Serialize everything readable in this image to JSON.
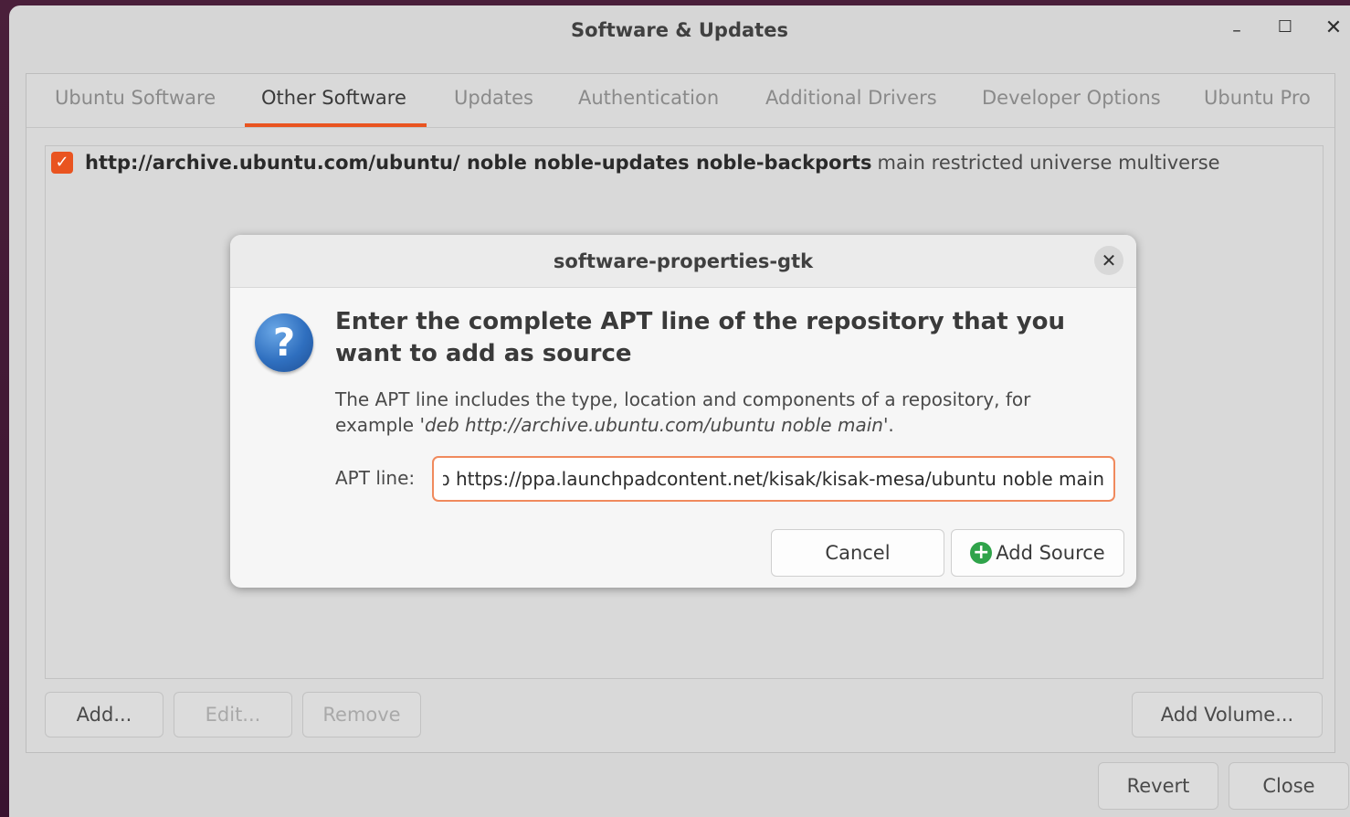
{
  "window": {
    "title": "Software & Updates",
    "minimize_glyph": "–",
    "maximize_glyph": "☐",
    "close_glyph": "✕"
  },
  "tabs": [
    {
      "label": "Ubuntu Software",
      "active": false
    },
    {
      "label": "Other Software",
      "active": true
    },
    {
      "label": "Updates",
      "active": false
    },
    {
      "label": "Authentication",
      "active": false
    },
    {
      "label": "Additional Drivers",
      "active": false
    },
    {
      "label": "Developer Options",
      "active": false
    },
    {
      "label": "Ubuntu Pro",
      "active": false
    }
  ],
  "repositories": [
    {
      "checked": true,
      "url_and_suites": "http://archive.ubuntu.com/ubuntu/ noble noble-updates noble-backports",
      "components": "main restricted universe multiverse"
    }
  ],
  "list_buttons": {
    "add": "Add...",
    "edit": "Edit...",
    "remove": "Remove",
    "add_volume": "Add Volume..."
  },
  "footer_buttons": {
    "revert": "Revert",
    "close": "Close"
  },
  "dialog": {
    "title": "software-properties-gtk",
    "close_glyph": "✕",
    "icon_glyph": "?",
    "heading": "Enter the complete APT line of the repository that you want to add as source",
    "desc_before": "The APT line includes the type, location and components of a repository, for example  '",
    "desc_example": "deb http://archive.ubuntu.com/ubuntu noble main",
    "desc_after": "'.",
    "apt_label": "APT line:",
    "apt_value": "deb https://ppa.launchpadcontent.net/kisak/kisak-mesa/ubuntu noble main",
    "cancel": "Cancel",
    "add_source": "Add Source",
    "plus_glyph": "+"
  },
  "colors": {
    "accent": "#e95420",
    "input_focus_border": "#f08a5d",
    "add_icon": "#2fa34a",
    "question_icon": "#2f6fbf"
  }
}
